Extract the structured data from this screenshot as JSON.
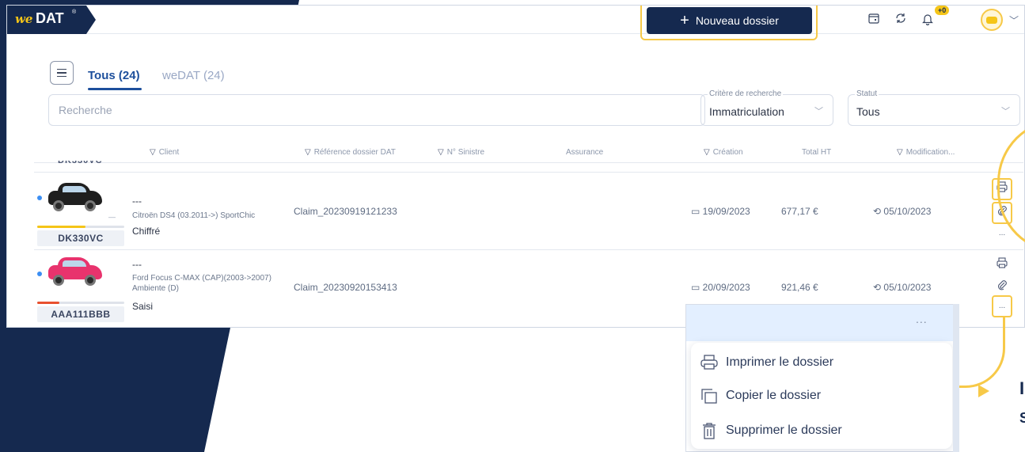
{
  "app": {
    "logo_we": "we",
    "logo_dat": "DAT",
    "logo_reg": "®"
  },
  "header": {
    "new_button_label": "Nouveau dossier",
    "notification_badge": "+0"
  },
  "tabs": [
    {
      "label": "Tous (24)"
    },
    {
      "label": "weDAT (24)"
    }
  ],
  "search": {
    "placeholder": "Recherche"
  },
  "filters": {
    "criteria_label": "Critère de recherche",
    "criteria_value": "Immatriculation",
    "status_label": "Statut",
    "status_value": "Tous"
  },
  "columns": [
    "Client",
    "Référence dossier DAT",
    "N° Sinistre",
    "Assurance",
    "Création",
    "Total HT",
    "Modification..."
  ],
  "partial_plate": "DK330VC",
  "rows": [
    {
      "client": "---",
      "model": "Citroën DS4 (03.2011->) SportChic",
      "status": "Chiffré",
      "plate": "DK330VC",
      "reference": "Claim_20230919121233",
      "creation": "19/09/2023",
      "total": "677,17 €",
      "modification": "05/10/2023",
      "dash": "—",
      "progress": 0.55,
      "progress_color": "#f5c518",
      "car_color": "#1f1f1f"
    },
    {
      "client": "---",
      "model": "Ford Focus C-MAX (CAP)(2003->2007) Ambiente (D)",
      "status": "Saisi",
      "plate": "AAA111BBB",
      "reference": "Claim_20230920153413",
      "creation": "20/09/2023",
      "total": "921,46 €",
      "modification": "05/10/2023",
      "dash": "",
      "progress": 0.25,
      "progress_color": "#e8502e",
      "car_color": "#e8336d"
    }
  ],
  "more_label": "...",
  "dropdown": {
    "header_dots": "...",
    "items": [
      {
        "label": "Imprimer le dossier",
        "icon": "printer-icon"
      },
      {
        "label": "Copier le dossier",
        "icon": "copy-icon"
      },
      {
        "label": "Supprimer le dossier",
        "icon": "trash-icon"
      }
    ]
  },
  "side_text": {
    "line1": "I",
    "line2": "S"
  },
  "colors": {
    "navy": "#15294f",
    "accent_yellow": "#f7c948",
    "link_blue": "#1d4f9c"
  }
}
